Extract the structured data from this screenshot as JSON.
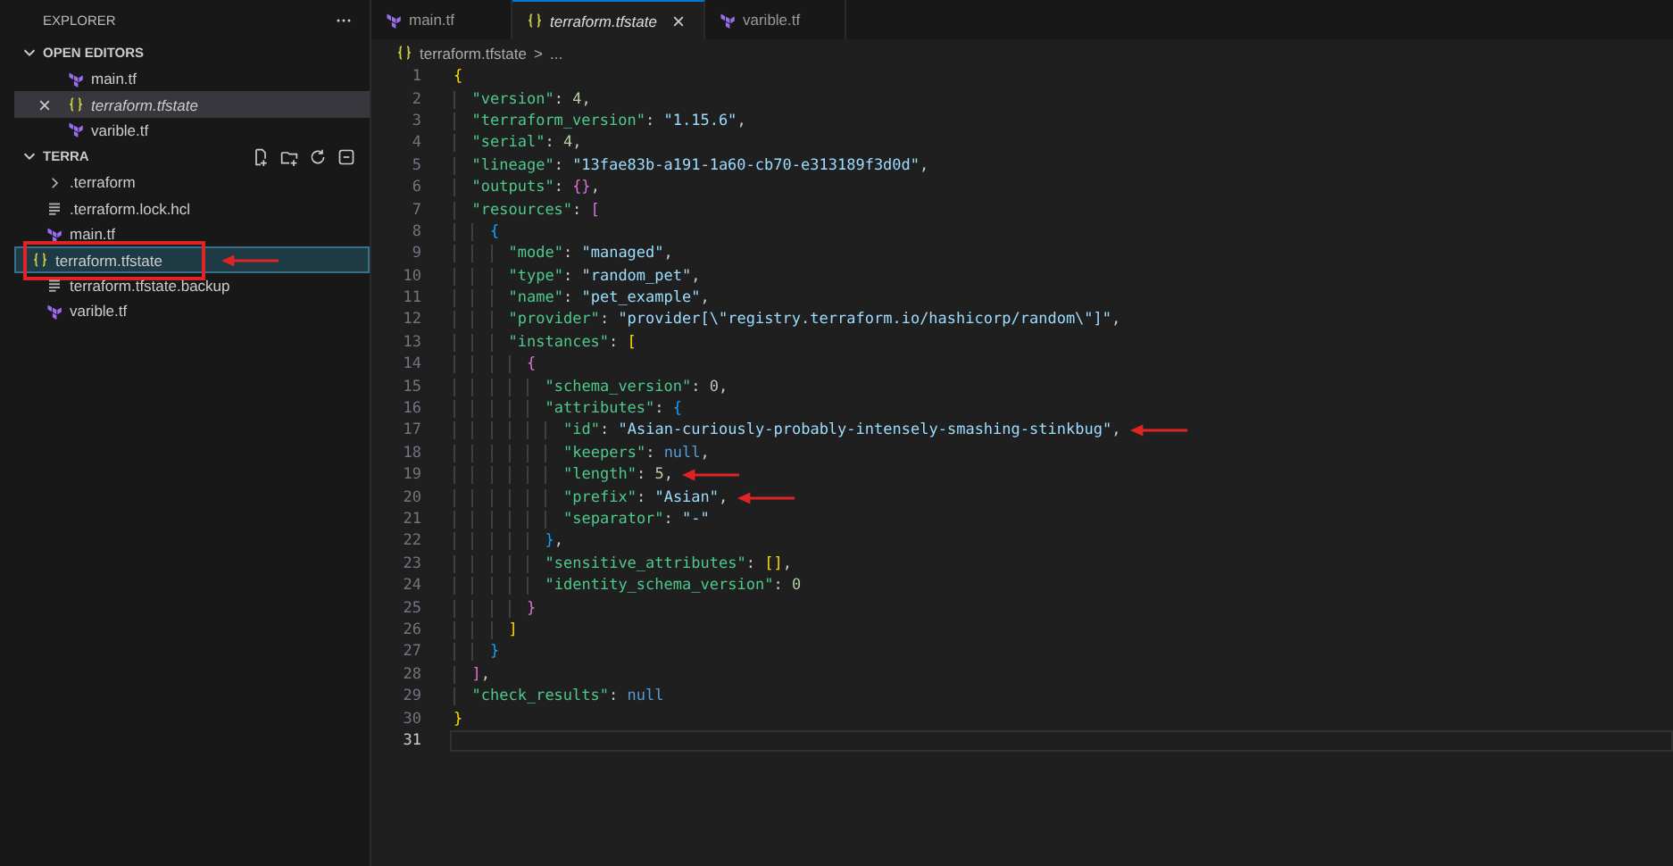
{
  "sidebar": {
    "title": "EXPLORER",
    "sections": [
      {
        "title": "OPEN EDITORS",
        "expanded": true,
        "toolbar": false,
        "items": [
          {
            "name": "main.tf",
            "kind": "terraform",
            "selected": false,
            "preview": false,
            "marked": false,
            "arrow": false
          },
          {
            "name": "terraform.tfstate",
            "kind": "json",
            "selected": true,
            "preview": true,
            "marked": false,
            "arrow": false
          },
          {
            "name": "varible.tf",
            "kind": "terraform",
            "selected": false,
            "preview": false,
            "marked": false,
            "arrow": false
          }
        ]
      },
      {
        "title": "TERRA",
        "expanded": true,
        "toolbar": true,
        "items": [
          {
            "name": ".terraform",
            "kind": "folder",
            "selected": false,
            "preview": false,
            "marked": false,
            "arrow": false
          },
          {
            "name": ".terraform.lock.hcl",
            "kind": "lines",
            "selected": false,
            "preview": false,
            "marked": false,
            "arrow": false
          },
          {
            "name": "main.tf",
            "kind": "terraform",
            "selected": false,
            "preview": false,
            "marked": false,
            "arrow": false
          },
          {
            "name": "terraform.tfstate",
            "kind": "json",
            "selected": true,
            "preview": false,
            "marked": true,
            "arrow": true
          },
          {
            "name": "terraform.tfstate.backup",
            "kind": "lines",
            "selected": false,
            "preview": false,
            "marked": false,
            "arrow": false
          },
          {
            "name": "varible.tf",
            "kind": "terraform",
            "selected": false,
            "preview": false,
            "marked": false,
            "arrow": false
          }
        ]
      }
    ]
  },
  "tabs": [
    {
      "label": "main.tf",
      "kind": "terraform",
      "selected": false,
      "preview": false
    },
    {
      "label": "terraform.tfstate",
      "kind": "json",
      "selected": true,
      "preview": true
    },
    {
      "label": "varible.tf",
      "kind": "terraform",
      "selected": false,
      "preview": false
    }
  ],
  "breadcrumb": {
    "file": "terraform.tfstate",
    "separator": ">",
    "rest": "..."
  },
  "lines": [
    {
      "number": "1",
      "current": false,
      "arrow": false,
      "tokens": [
        {
          "kind": "b1",
          "text": "{"
        }
      ]
    },
    {
      "number": "2",
      "current": false,
      "arrow": false,
      "tokens": [
        {
          "kind": "key",
          "text": "  \"version\""
        },
        {
          "kind": "p",
          "text": ": "
        },
        {
          "kind": "num",
          "text": "4"
        },
        {
          "kind": "p",
          "text": ","
        }
      ]
    },
    {
      "number": "3",
      "current": false,
      "arrow": false,
      "tokens": [
        {
          "kind": "key",
          "text": "  \"terraform_version\""
        },
        {
          "kind": "p",
          "text": ": "
        },
        {
          "kind": "str",
          "text": "\"1.15.6\""
        },
        {
          "kind": "p",
          "text": ","
        }
      ]
    },
    {
      "number": "4",
      "current": false,
      "arrow": false,
      "tokens": [
        {
          "kind": "key",
          "text": "  \"serial\""
        },
        {
          "kind": "p",
          "text": ": "
        },
        {
          "kind": "num",
          "text": "4"
        },
        {
          "kind": "p",
          "text": ","
        }
      ]
    },
    {
      "number": "5",
      "current": false,
      "arrow": false,
      "tokens": [
        {
          "kind": "key",
          "text": "  \"lineage\""
        },
        {
          "kind": "p",
          "text": ": "
        },
        {
          "kind": "str",
          "text": "\"13fae83b-a191-1a60-cb70-e313189f3d0d\""
        },
        {
          "kind": "p",
          "text": ","
        }
      ]
    },
    {
      "number": "6",
      "current": false,
      "arrow": false,
      "tokens": [
        {
          "kind": "key",
          "text": "  \"outputs\""
        },
        {
          "kind": "p",
          "text": ": "
        },
        {
          "kind": "b2",
          "text": "{}"
        },
        {
          "kind": "p",
          "text": ","
        }
      ]
    },
    {
      "number": "7",
      "current": false,
      "arrow": false,
      "tokens": [
        {
          "kind": "key",
          "text": "  \"resources\""
        },
        {
          "kind": "p",
          "text": ": "
        },
        {
          "kind": "b2",
          "text": "["
        }
      ]
    },
    {
      "number": "8",
      "current": false,
      "arrow": false,
      "tokens": [
        {
          "kind": "b3",
          "text": "    {"
        }
      ]
    },
    {
      "number": "9",
      "current": false,
      "arrow": false,
      "tokens": [
        {
          "kind": "key",
          "text": "      \"mode\""
        },
        {
          "kind": "p",
          "text": ": "
        },
        {
          "kind": "str",
          "text": "\"managed\""
        },
        {
          "kind": "p",
          "text": ","
        }
      ]
    },
    {
      "number": "10",
      "current": false,
      "arrow": false,
      "tokens": [
        {
          "kind": "key",
          "text": "      \"type\""
        },
        {
          "kind": "p",
          "text": ": "
        },
        {
          "kind": "str",
          "text": "\"random_pet\""
        },
        {
          "kind": "p",
          "text": ","
        }
      ]
    },
    {
      "number": "11",
      "current": false,
      "arrow": false,
      "tokens": [
        {
          "kind": "key",
          "text": "      \"name\""
        },
        {
          "kind": "p",
          "text": ": "
        },
        {
          "kind": "str",
          "text": "\"pet_example\""
        },
        {
          "kind": "p",
          "text": ","
        }
      ]
    },
    {
      "number": "12",
      "current": false,
      "arrow": false,
      "tokens": [
        {
          "kind": "key",
          "text": "      \"provider\""
        },
        {
          "kind": "p",
          "text": ": "
        },
        {
          "kind": "str",
          "text": "\"provider[\\\"registry.terraform.io/hashicorp/random\\\"]\""
        },
        {
          "kind": "p",
          "text": ","
        }
      ]
    },
    {
      "number": "13",
      "current": false,
      "arrow": false,
      "tokens": [
        {
          "kind": "key",
          "text": "      \"instances\""
        },
        {
          "kind": "p",
          "text": ": "
        },
        {
          "kind": "b1",
          "text": "["
        }
      ]
    },
    {
      "number": "14",
      "current": false,
      "arrow": false,
      "tokens": [
        {
          "kind": "b2",
          "text": "        {"
        }
      ]
    },
    {
      "number": "15",
      "current": false,
      "arrow": false,
      "tokens": [
        {
          "kind": "key",
          "text": "          \"schema_version\""
        },
        {
          "kind": "p",
          "text": ": "
        },
        {
          "kind": "num",
          "text": "0"
        },
        {
          "kind": "p",
          "text": ","
        }
      ]
    },
    {
      "number": "16",
      "current": false,
      "arrow": false,
      "tokens": [
        {
          "kind": "key",
          "text": "          \"attributes\""
        },
        {
          "kind": "p",
          "text": ": "
        },
        {
          "kind": "b3",
          "text": "{"
        }
      ]
    },
    {
      "number": "17",
      "current": false,
      "arrow": true,
      "tokens": [
        {
          "kind": "key",
          "text": "            \"id\""
        },
        {
          "kind": "p",
          "text": ": "
        },
        {
          "kind": "str",
          "text": "\"Asian-curiously-probably-intensely-smashing-stinkbug\""
        },
        {
          "kind": "p",
          "text": ","
        }
      ]
    },
    {
      "number": "18",
      "current": false,
      "arrow": false,
      "tokens": [
        {
          "kind": "key",
          "text": "            \"keepers\""
        },
        {
          "kind": "p",
          "text": ": "
        },
        {
          "kind": "lit",
          "text": "null"
        },
        {
          "kind": "p",
          "text": ","
        }
      ]
    },
    {
      "number": "19",
      "current": false,
      "arrow": true,
      "tokens": [
        {
          "kind": "key",
          "text": "            \"length\""
        },
        {
          "kind": "p",
          "text": ": "
        },
        {
          "kind": "num",
          "text": "5"
        },
        {
          "kind": "p",
          "text": ","
        }
      ]
    },
    {
      "number": "20",
      "current": false,
      "arrow": true,
      "tokens": [
        {
          "kind": "key",
          "text": "            \"prefix\""
        },
        {
          "kind": "p",
          "text": ": "
        },
        {
          "kind": "str",
          "text": "\"Asian\""
        },
        {
          "kind": "p",
          "text": ","
        }
      ]
    },
    {
      "number": "21",
      "current": false,
      "arrow": false,
      "tokens": [
        {
          "kind": "key",
          "text": "            \"separator\""
        },
        {
          "kind": "p",
          "text": ": "
        },
        {
          "kind": "str",
          "text": "\"-\""
        }
      ]
    },
    {
      "number": "22",
      "current": false,
      "arrow": false,
      "tokens": [
        {
          "kind": "b3",
          "text": "          }"
        },
        {
          "kind": "p",
          "text": ","
        }
      ]
    },
    {
      "number": "23",
      "current": false,
      "arrow": false,
      "tokens": [
        {
          "kind": "key",
          "text": "          \"sensitive_attributes\""
        },
        {
          "kind": "p",
          "text": ": "
        },
        {
          "kind": "b1",
          "text": "[]"
        },
        {
          "kind": "p",
          "text": ","
        }
      ]
    },
    {
      "number": "24",
      "current": false,
      "arrow": false,
      "tokens": [
        {
          "kind": "key",
          "text": "          \"identity_schema_version\""
        },
        {
          "kind": "p",
          "text": ": "
        },
        {
          "kind": "num",
          "text": "0"
        }
      ]
    },
    {
      "number": "25",
      "current": false,
      "arrow": false,
      "tokens": [
        {
          "kind": "b2",
          "text": "        }"
        }
      ]
    },
    {
      "number": "26",
      "current": false,
      "arrow": false,
      "tokens": [
        {
          "kind": "b1",
          "text": "      ]"
        }
      ]
    },
    {
      "number": "27",
      "current": false,
      "arrow": false,
      "tokens": [
        {
          "kind": "b3",
          "text": "    }"
        }
      ]
    },
    {
      "number": "28",
      "current": false,
      "arrow": false,
      "tokens": [
        {
          "kind": "b2",
          "text": "  ]"
        },
        {
          "kind": "p",
          "text": ","
        }
      ]
    },
    {
      "number": "29",
      "current": false,
      "arrow": false,
      "tokens": [
        {
          "kind": "key",
          "text": "  \"check_results\""
        },
        {
          "kind": "p",
          "text": ": "
        },
        {
          "kind": "lit",
          "text": "null"
        }
      ]
    },
    {
      "number": "30",
      "current": false,
      "arrow": false,
      "tokens": [
        {
          "kind": "b1",
          "text": "}"
        }
      ]
    },
    {
      "number": "31",
      "current": true,
      "arrow": false
    }
  ]
}
